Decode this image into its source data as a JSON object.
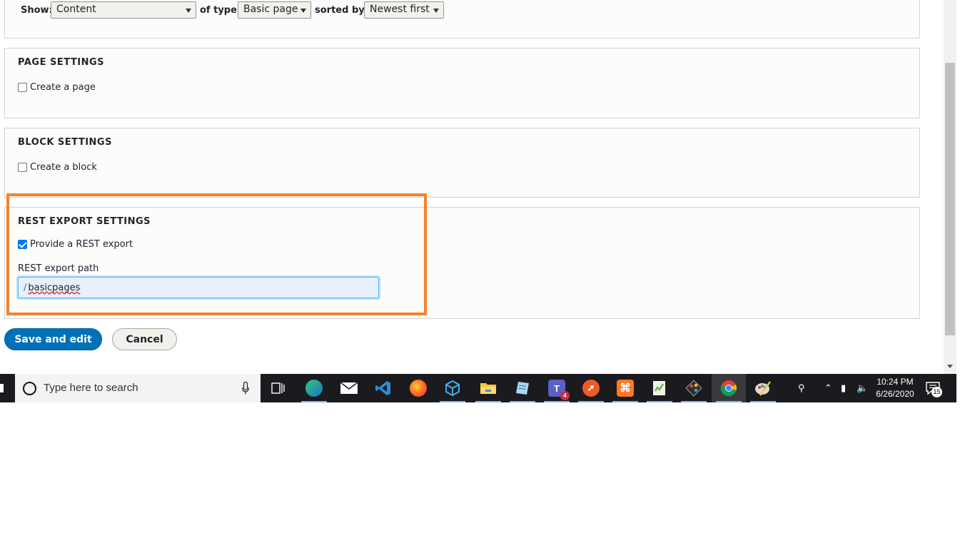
{
  "filters": {
    "show_label": "Show:",
    "show_value": "Content",
    "type_label": "of type:",
    "type_value": "Basic page",
    "sort_label": "sorted by:",
    "sort_value": "Newest first"
  },
  "page_settings": {
    "legend": "PAGE SETTINGS",
    "checkbox_label": "Create a page",
    "checked": false
  },
  "block_settings": {
    "legend": "BLOCK SETTINGS",
    "checkbox_label": "Create a block",
    "checked": false
  },
  "rest_settings": {
    "legend": "REST EXPORT SETTINGS",
    "checkbox_label": "Provide a REST export",
    "checked": true,
    "path_label": "REST export path",
    "path_prefix": "/",
    "path_value": "basicpages"
  },
  "actions": {
    "save_label": "Save and edit",
    "cancel_label": "Cancel"
  },
  "colors": {
    "highlight": "#f5822b",
    "primary_button": "#0071b8"
  },
  "taskbar": {
    "search_placeholder": "Type here to search",
    "time": "10:24 PM",
    "date": "6/26/2020",
    "teams_badge": "4",
    "notification_count": "15",
    "apps": [
      "task-view",
      "edge",
      "mail",
      "vscode",
      "firefox",
      "3d-viewer",
      "file-explorer",
      "notepad-doc",
      "teams",
      "postman",
      "xampp",
      "notepad-plus",
      "git",
      "chrome",
      "paint"
    ]
  }
}
